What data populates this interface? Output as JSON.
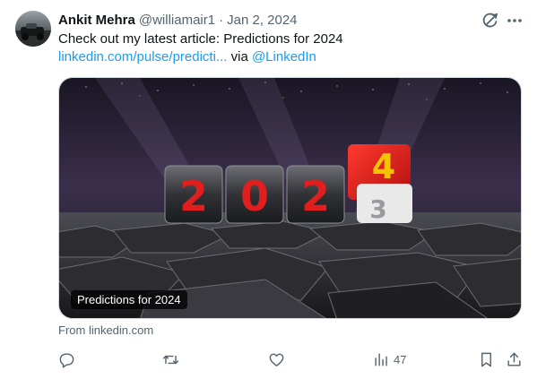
{
  "tweet": {
    "author_name": "Ankit Mehra",
    "author_handle": "@williamair1",
    "separator": "·",
    "date": "Jan 2, 2024",
    "text_prefix": "Check out my latest article: Predictions for 2024",
    "link_text": "linkedin.com/pulse/predicti...",
    "via_text": " via ",
    "mention": "@LinkedIn"
  },
  "card": {
    "caption": "Predictions for 2024",
    "source": "From linkedin.com",
    "image_digits": [
      "2",
      "0",
      "2",
      "4",
      "3"
    ]
  },
  "actions": {
    "reply_icon": "reply-icon",
    "retweet_icon": "retweet-icon",
    "like_icon": "like-icon",
    "views_icon": "views-icon",
    "views_count": "47",
    "bookmark_icon": "bookmark-icon",
    "share_icon": "share-icon"
  },
  "colors": {
    "link": "#1d9bf0",
    "secondary_text": "#536471",
    "primary_text": "#0f1419"
  }
}
